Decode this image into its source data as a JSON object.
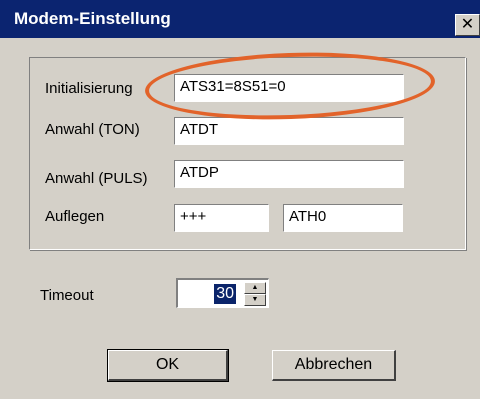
{
  "window": {
    "title": "Modem-Einstellung",
    "close_glyph": "✕",
    "close_icon": "close-icon"
  },
  "fields": {
    "init": {
      "label": "Initialisierung",
      "value": "ATS31=8S51=0"
    },
    "tone": {
      "label": "Anwahl (TON)",
      "value": "ATDT"
    },
    "pulse": {
      "label": "Anwahl (PULS)",
      "value": "ATDP"
    },
    "hangup": {
      "label": "Auflegen",
      "value1": "+++",
      "value2": "ATH0"
    }
  },
  "timeout": {
    "label": "Timeout",
    "value": "30",
    "up_glyph": "▲",
    "down_glyph": "▼"
  },
  "buttons": {
    "ok": "OK",
    "cancel": "Abbrechen"
  },
  "colors": {
    "highlight_ellipse": "#e2632a",
    "titlebar": "#0b2470",
    "dialog_bg": "#d4d0c8"
  }
}
